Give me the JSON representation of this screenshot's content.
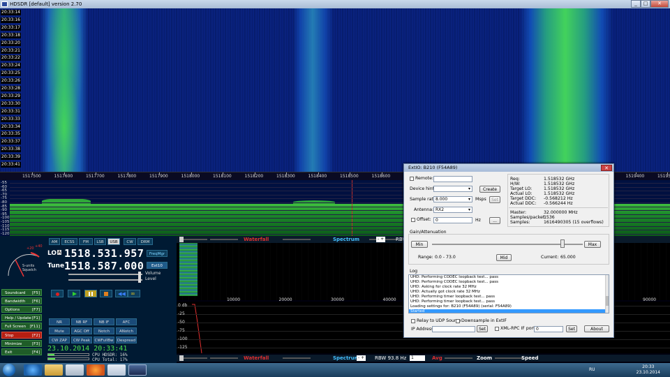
{
  "window": {
    "title": "HDSDR [default]  version 2.70"
  },
  "waterfall": {
    "timestamps": [
      "20:33:14",
      "20:33:16",
      "20:33:17",
      "20:33:18",
      "20:33:20",
      "20:33:21",
      "20:33:22",
      "20:33:24",
      "20:33:25",
      "20:33:26",
      "20:33:28",
      "20:33:29",
      "20:33:30",
      "20:33:31",
      "20:33:33",
      "20:33:34",
      "20:33:35",
      "20:33:37",
      "20:33:38",
      "20:33:39",
      "20:33:41"
    ]
  },
  "freq_axis": {
    "labels": [
      "1517500",
      "1517600",
      "1517700",
      "1517800",
      "1517900",
      "1518000",
      "1518100",
      "1518200",
      "1518300",
      "1518400",
      "1518500",
      "1518600",
      "1518700",
      "1518800",
      "1518900",
      "1519000",
      "1519100",
      "1519200",
      "1519300",
      "1519400",
      "1519500"
    ]
  },
  "spectrum": {
    "db_labels": [
      "-55",
      "-60",
      "-65",
      "-70",
      "-75",
      "-80",
      "-85",
      "-90",
      "-95",
      "-100",
      "-105",
      "-110",
      "-115",
      "-120"
    ]
  },
  "smeter": {
    "label1": "S-units",
    "label2": "Squelch",
    "scale_top": "+20",
    "scale_top2": "+40"
  },
  "modes": [
    "AM",
    "ECSS",
    "FM",
    "LSB",
    "USB",
    "CW",
    "DRM"
  ],
  "lo": {
    "label": "LO",
    "letter": "A",
    "value": "1518.531.957"
  },
  "tune": {
    "label": "Tune",
    "value": "1518.587.000"
  },
  "freqmgr": "FreqMgr",
  "ext10": "Ext10",
  "volume": "Volume",
  "level": "Level",
  "left_buttons": [
    {
      "label": "Soundcard",
      "key": "[F5]"
    },
    {
      "label": "Bandwidth",
      "key": "[F6]"
    },
    {
      "label": "Options",
      "key": "[F7]"
    },
    {
      "label": "Help / Update",
      "key": "[F1]"
    },
    {
      "label": "Full Screen",
      "key": "[F11]"
    },
    {
      "label": "Stop",
      "key": "[F2]"
    },
    {
      "label": "Minimize",
      "key": "[F3]"
    },
    {
      "label": "Exit",
      "key": "[F4]"
    }
  ],
  "nr_buttons": [
    "NR",
    "NB RF",
    "NB IF",
    "AFC",
    "Mute",
    "AGC Off",
    "Notch",
    "ANotch",
    "CW ZAP",
    "CW Peak",
    "CWFullBw",
    "Despread"
  ],
  "datetime": "23.10.2014 20:33:41",
  "cpu": {
    "hdsdr": "CPU HDSDR: 16%",
    "total": "CPU Total: 17%"
  },
  "top_bar": {
    "waterfall": "Waterfall",
    "spectrum": "Spectrum",
    "rbw": "RBW 30.5 Hz"
  },
  "bottom_bar": {
    "waterfall": "Waterfall",
    "spectrum": "Spectrum",
    "rbw": "RBW 93.8 Hz",
    "avg": "Avg",
    "zoom": "Zoom",
    "speed": "Speed",
    "avg_value": "1"
  },
  "audio_axis": [
    "10000",
    "20000",
    "30000",
    "40000",
    "50000",
    "60000",
    "70000",
    "80000",
    "90000"
  ],
  "audio_db": [
    "0 db",
    "-25",
    "-50",
    "-75",
    "-100",
    "-125"
  ],
  "dialog": {
    "title": "ExtIO: B210 (F54A89)",
    "remote": "Remote:",
    "device_hint": "Device hint:",
    "create": "Create",
    "sample_rate": "Sample rate:",
    "sample_rate_value": "8.000",
    "msps": "Msps",
    "set": "Set",
    "antenna": "Antenna:",
    "antenna_value": "RX2",
    "offset": "Offset:",
    "offset_value": "0",
    "hz": "Hz",
    "ellipsis": "...",
    "req_label": "Req:",
    "req": "1.518532 GHz",
    "hw_label": "H/W:",
    "hw": "1.518532 GHz",
    "target_lo_label": "Target LO:",
    "target_lo": "1.518532 GHz",
    "actual_lo_label": "Actual LO:",
    "actual_lo": "1.518532 GHz",
    "target_ddc_label": "Target DDC:",
    "target_ddc": "-0.568212 Hz",
    "actual_ddc_label": "Actual DDC:",
    "actual_ddc": "-0.566244 Hz",
    "master_label": "Master:",
    "master": "32.000000 MHz",
    "spp_label": "Samples/packet:",
    "spp": "1536",
    "samples_label": "Samples:",
    "samples": "1616490305 (15 overflows)",
    "gain_title": "Gain/Attenuation",
    "min": "Min",
    "max": "Max",
    "mid": "Mid",
    "range_label": "Range:",
    "range": "0.0 - 73.0",
    "current_label": "Current:",
    "current": "65.000",
    "log_title": "Log",
    "log": [
      "UHD: Performing CODEC loopback test... pass",
      "UHD: Performing CODEC loopback test... pass",
      "UHD: Asking for clock rate 32 MHz",
      "UHD: Actually got clock rate 32 MHz",
      "UHD: Performing timer loopback test... pass",
      "UHD: Performing timer loopback test... pass",
      "Loading settings for: B210 (F54A89) (serial: F54A89)",
      "Started"
    ],
    "relay": "Relay to UDP Source",
    "dc_offset": "Downsample in ExtIF",
    "ip_address": "IP Address:",
    "xmlrpc": "XML-RPC IF port:",
    "xmlrpc_value": "0",
    "about": "About"
  },
  "taskbar": {
    "lang": "RU",
    "time": "20:33",
    "date": "23.10.2014"
  }
}
